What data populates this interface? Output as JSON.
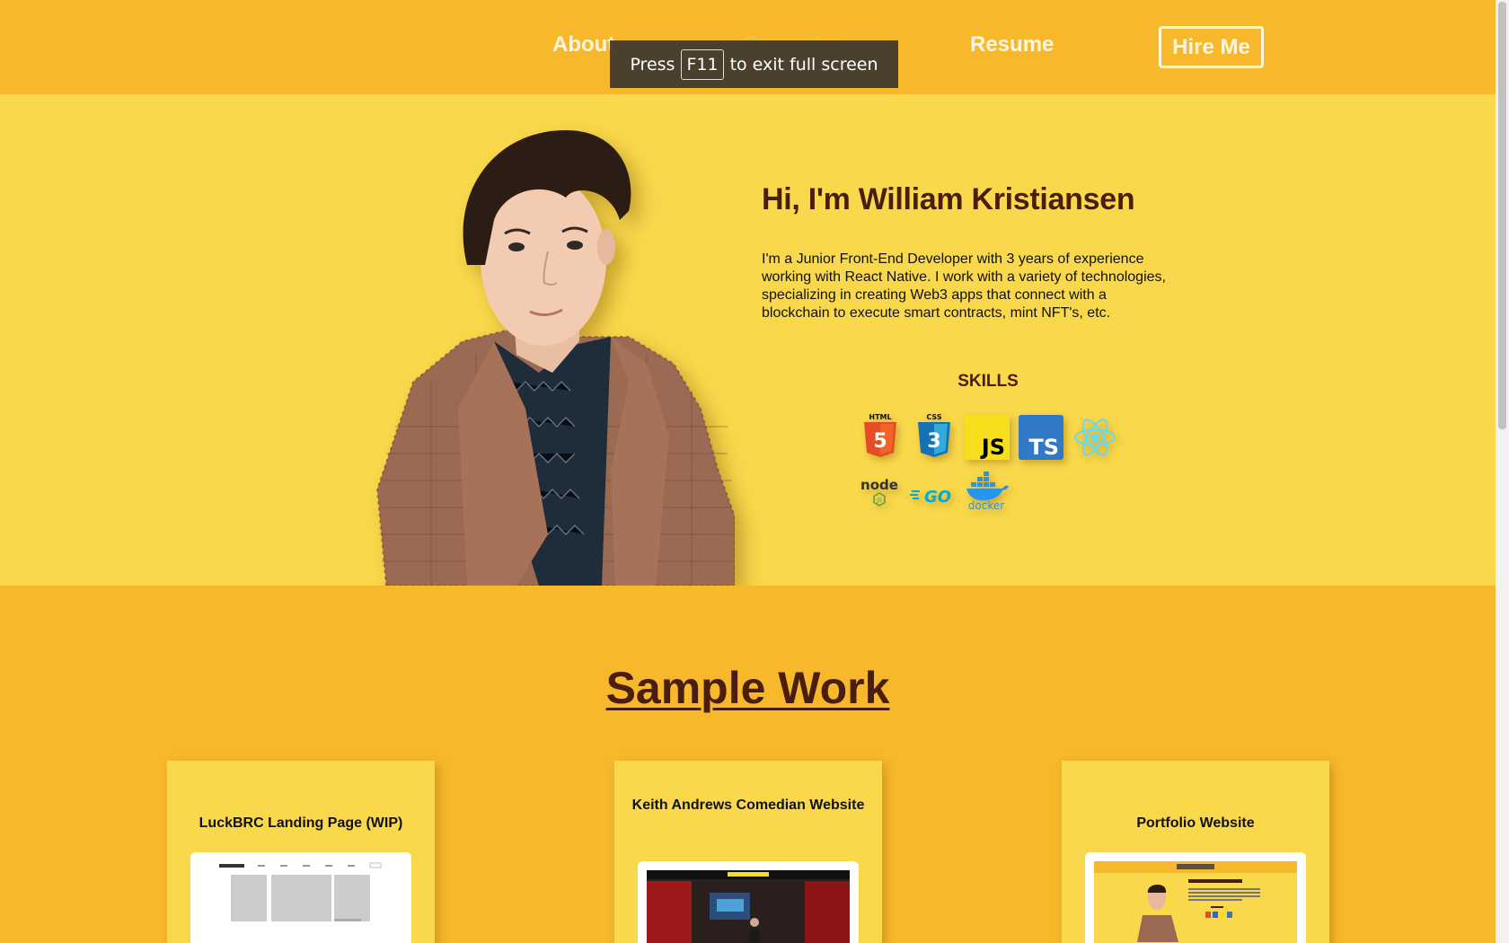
{
  "nav": {
    "links": [
      "About",
      "Examples",
      "Resume"
    ],
    "hire_label": "Hire Me"
  },
  "fullscreen_toast": {
    "before": "Press",
    "key": "F11",
    "after": "to exit full screen"
  },
  "hero": {
    "title": "Hi, I'm William Kristiansen",
    "description": "I'm a Junior Front-End Developer with 3 years of experience working with React Native. I work with a variety of technologies, specializing in creating Web3 apps that connect with a blockchain to execute smart contracts, mint NFT's, etc.",
    "skills_heading": "SKILLS",
    "skills": [
      {
        "icon": "html5-icon",
        "label": "HTML",
        "color": "#e44d26"
      },
      {
        "icon": "css3-icon",
        "label": "CSS",
        "color": "#2965f1"
      },
      {
        "icon": "javascript-icon",
        "label": "JS",
        "color": "#f7df1e"
      },
      {
        "icon": "typescript-icon",
        "label": "TS",
        "color": "#3178c6"
      },
      {
        "icon": "react-icon",
        "color": "#61dafb"
      },
      {
        "icon": "nodejs-icon",
        "label": "node",
        "color": "#333333"
      },
      {
        "icon": "go-icon",
        "label": "GO",
        "color": "#00add8"
      },
      {
        "icon": "docker-icon",
        "label": "docker",
        "color": "#2496ed"
      }
    ]
  },
  "sample_work": {
    "heading": "Sample Work",
    "cards": [
      {
        "title": "LuckBRC Landing Page (WIP)"
      },
      {
        "title": "Keith Andrews Comedian Website"
      },
      {
        "title": "Portfolio Website"
      }
    ]
  },
  "colors": {
    "nav_bg": "#f7b82b",
    "hero_bg": "#f9d84b",
    "heading": "#4a1e0c"
  }
}
